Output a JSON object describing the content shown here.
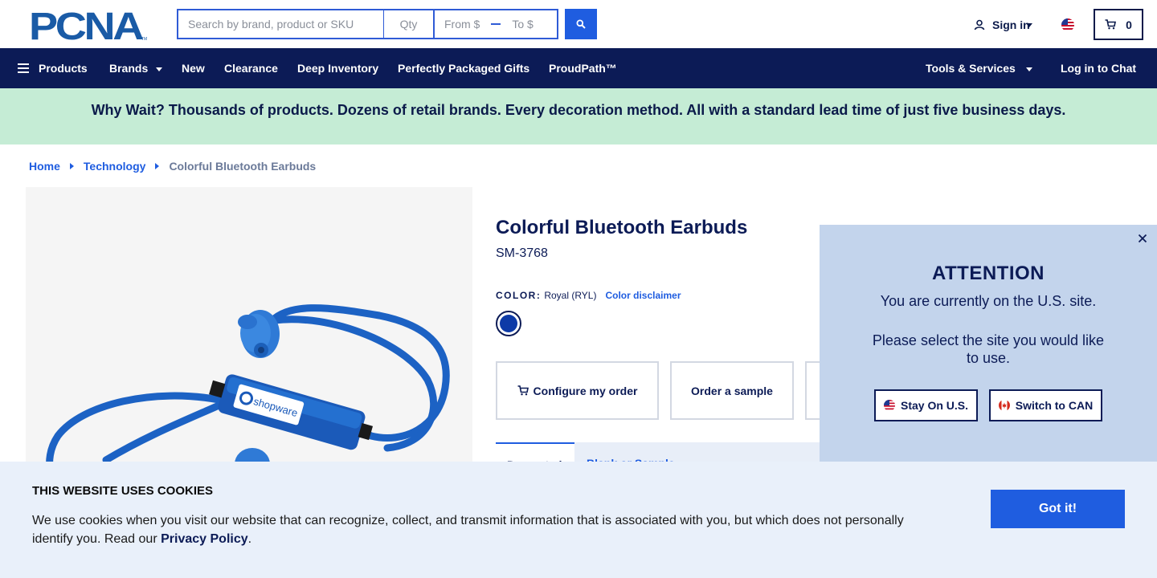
{
  "header": {
    "logo_text": "PCNA",
    "search_placeholder": "Search by brand, product or SKU",
    "qty_placeholder": "Qty",
    "from_placeholder": "From $",
    "to_placeholder": "To $",
    "search_icon": "search-icon",
    "signin_label": "Sign in",
    "cart_count": "0"
  },
  "nav": {
    "products": "Products",
    "brands": "Brands",
    "new": "New",
    "clearance": "Clearance",
    "deep_inventory": "Deep Inventory",
    "gifts": "Perfectly Packaged Gifts",
    "proudpath": "ProudPath™",
    "tools": "Tools & Services",
    "chat": "Log in to Chat"
  },
  "banner": {
    "text": "Why Wait? Thousands of products. Dozens of retail brands. Every decoration method. All with a standard lead time of just five business days."
  },
  "breadcrumb": {
    "home": "Home",
    "category": "Technology",
    "current": "Colorful Bluetooth Earbuds"
  },
  "product": {
    "title": "Colorful Bluetooth Earbuds",
    "sku": "SM-3768",
    "color_label": "COLOR:",
    "color_value": "Royal (RYL)",
    "color_disclaimer": "Color disclaimer",
    "swatch_color": "#0d3aa7",
    "image_brand": "shopware",
    "configure_label": "Configure my order",
    "sample_label": "Order a sample",
    "tab1": "Decorated",
    "tab2": "Blank or Sample"
  },
  "popup": {
    "title": "ATTENTION",
    "line1": "You are currently on the U.S. site.",
    "line2": "Please select the site you would like to use.",
    "stay_label": "Stay On U.S.",
    "switch_label": "Switch to CAN"
  },
  "cookie": {
    "title": "THIS WEBSITE USES COOKIES",
    "text": "We use cookies when you visit our website that can recognize, collect, and transmit information that is associated with you, but which does not personally identify you. Read our",
    "link": "Privacy Policy",
    "period": ".",
    "button": "Got it!"
  },
  "colors": {
    "navy": "#0c1b56",
    "accent_blue": "#1f5de0",
    "banner_green": "#c5ecd5",
    "popup_bg": "#c3d4ec",
    "cookie_bg": "#e9f0fa"
  }
}
